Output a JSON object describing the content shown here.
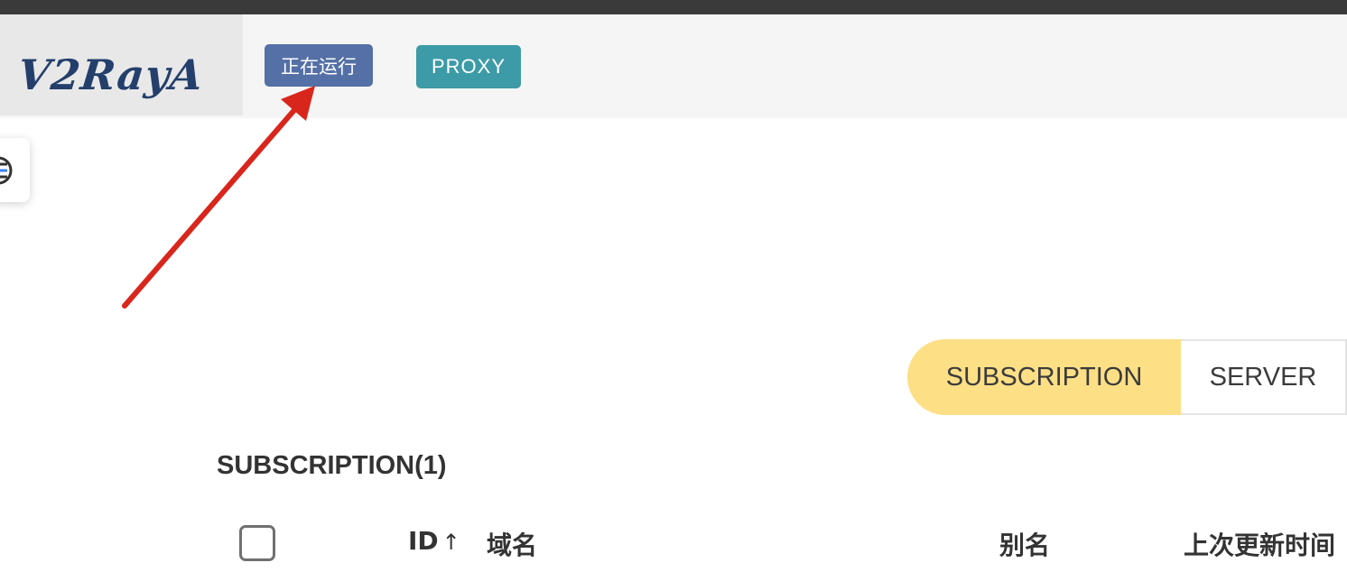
{
  "header": {
    "logo_text": "V2RayA",
    "status_button_label": "正在运行",
    "proxy_button_label": "PROXY"
  },
  "side_toggle": {
    "icon": "menu-icon"
  },
  "tabs": [
    {
      "label": "SUBSCRIPTION",
      "active": true
    },
    {
      "label": "SERVER",
      "active": false
    }
  ],
  "subscription": {
    "title": "SUBSCRIPTION(1)",
    "columns": {
      "id": "ID",
      "id_sort_icon": "↑",
      "domain": "域名",
      "alias": "别名",
      "last_updated": "上次更新时间"
    }
  },
  "colors": {
    "running": "#5470a6",
    "proxy": "#3c9ba6",
    "active_tab": "#fddf86",
    "annotation_arrow": "#d9261c"
  }
}
